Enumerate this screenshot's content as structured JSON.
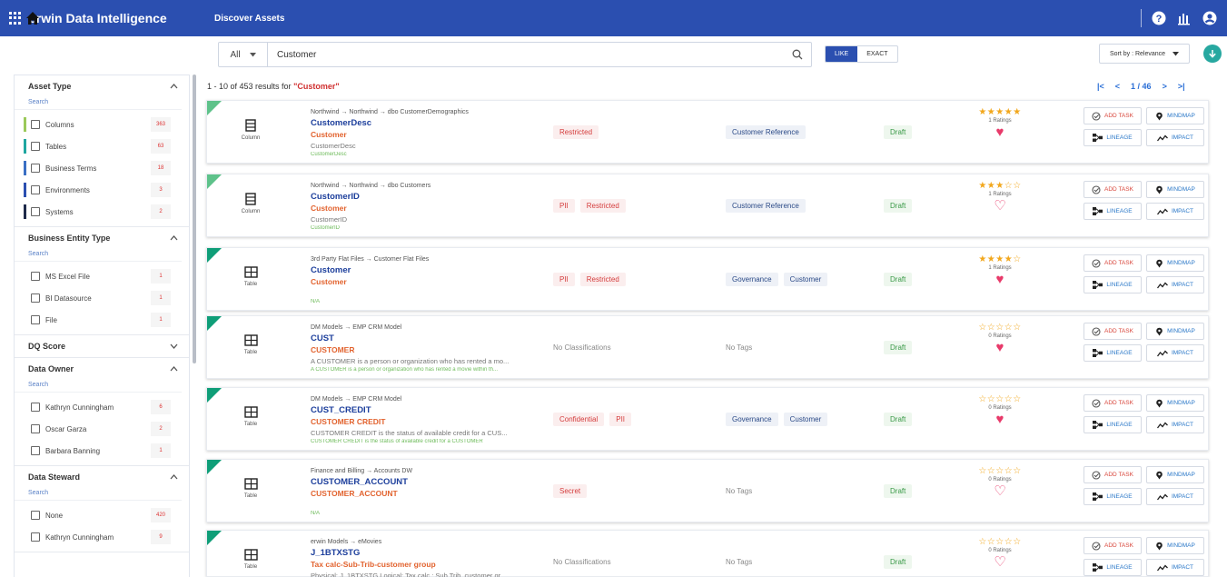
{
  "app": {
    "title": "erwin Data Intelligence",
    "section": "Discover Assets"
  },
  "search": {
    "scope": "All",
    "query": "Customer",
    "match_like": "LIKE",
    "match_exact": "EXACT"
  },
  "sort": {
    "label": "Sort by : Relevance"
  },
  "results": {
    "summary": "1 - 10 of 453 results for ",
    "term": "\"Customer\"",
    "page": "1 / 46"
  },
  "sidebar": {
    "facets": [
      {
        "title": "Asset Type",
        "search": "Search",
        "items": [
          {
            "label": "Columns",
            "count": "363",
            "color": "#9bc95a"
          },
          {
            "label": "Tables",
            "count": "63",
            "color": "#1fa6a0"
          },
          {
            "label": "Business Terms",
            "count": "18",
            "color": "#3a6fc4"
          },
          {
            "label": "Environments",
            "count": "3",
            "color": "#2b4fb0"
          },
          {
            "label": "Systems",
            "count": "2",
            "color": "#1e2a4a"
          }
        ]
      },
      {
        "title": "Business Entity Type",
        "search": "Search",
        "items": [
          {
            "label": "MS Excel File",
            "count": "1"
          },
          {
            "label": "BI Datasource",
            "count": "1"
          },
          {
            "label": "File",
            "count": "1"
          }
        ]
      },
      {
        "title": "DQ Score"
      },
      {
        "title": "Data Owner",
        "search": "Search",
        "items": [
          {
            "label": "Kathryn Cunningham",
            "count": "6"
          },
          {
            "label": "Oscar Garza",
            "count": "2"
          },
          {
            "label": "Barbara Banning",
            "count": "1"
          }
        ]
      },
      {
        "title": "Data Steward",
        "search": "Search",
        "items": [
          {
            "label": "None",
            "count": "420"
          },
          {
            "label": "Kathryn Cunningham",
            "count": "9"
          }
        ]
      }
    ]
  },
  "cards": [
    {
      "type": "Column",
      "path": "Northwind → Northwind → dbo CustomerDemographics",
      "name": "CustomerDesc",
      "business": "Customer",
      "desc": "CustomerDesc",
      "desc2": "CustomerDesc",
      "classifications": [
        "Restricted"
      ],
      "tags": [
        "Customer Reference"
      ],
      "status": "Draft",
      "stars": "★★★★★",
      "ratings": "1 Ratings",
      "heart": "♥"
    },
    {
      "type": "Column",
      "path": "Northwind → Northwind → dbo Customers",
      "name": "CustomerID",
      "business": "Customer",
      "desc": "CustomerID",
      "desc2": "CustomerID",
      "classifications": [
        "PII",
        "Restricted"
      ],
      "tags": [
        "Customer Reference"
      ],
      "status": "Draft",
      "stars": "★★★☆☆",
      "ratings": "1 Ratings",
      "heart": "♡"
    },
    {
      "type": "Table",
      "path": "3rd Party Flat Files → Customer Flat Files",
      "name": "Customer",
      "business": "Customer",
      "desc": "",
      "desc2": "N/A",
      "classifications": [
        "PII",
        "Restricted"
      ],
      "tags": [
        "Governance",
        "Customer"
      ],
      "status": "Draft",
      "stars": "★★★★☆",
      "ratings": "1 Ratings",
      "heart": "♥"
    },
    {
      "type": "Table",
      "path": "DM Models → EMP CRM Model",
      "name": "CUST",
      "business": "CUSTOMER",
      "desc": "A CUSTOMER is a person or organization who has rented a mo...",
      "desc2": "A CUSTOMER is a person or organization who has rented a movie within th...",
      "classifications": [],
      "classifications_empty": "No Classifications",
      "tags": [],
      "tags_empty": "No Tags",
      "status": "Draft",
      "stars": "☆☆☆☆☆",
      "ratings": "0 Ratings",
      "heart": "♥"
    },
    {
      "type": "Table",
      "path": "DM Models → EMP CRM Model",
      "name": "CUST_CREDIT",
      "business": "CUSTOMER CREDIT",
      "desc": "CUSTOMER CREDIT is the status of available credit for a CUS...",
      "desc2": "CUSTOMER CREDIT is the status of available credit for a CUSTOMER",
      "classifications": [
        "Confidential",
        "PII"
      ],
      "tags": [
        "Governance",
        "Customer"
      ],
      "status": "Draft",
      "stars": "☆☆☆☆☆",
      "ratings": "0 Ratings",
      "heart": "♥"
    },
    {
      "type": "Table",
      "path": "Finance and Billing → Accounts DW",
      "name": "CUSTOMER_ACCOUNT",
      "business": "CUSTOMER_ACCOUNT",
      "desc": "",
      "desc2": "N/A",
      "classifications": [
        "Secret"
      ],
      "tags": [],
      "tags_empty": "No Tags",
      "status": "Draft",
      "stars": "☆☆☆☆☆",
      "ratings": "0 Ratings",
      "heart": "♡"
    },
    {
      "type": "Table",
      "path": "erwin Models → eMovies",
      "name": "J_1BTXSTG",
      "business": "Tax calc-Sub-Trib-customer group",
      "desc": "Physical: J_1BTXSTG Logical: Tax calc.: Sub Trib. customer gr...",
      "desc2": "",
      "classifications": [],
      "classifications_empty": "No Classifications",
      "tags": [],
      "tags_empty": "No Tags",
      "status": "Draft",
      "stars": "☆☆☆☆☆",
      "ratings": "0 Ratings",
      "heart": "♡"
    }
  ],
  "actions": {
    "add_task": "ADD TASK",
    "mindmap": "MINDMAP",
    "lineage": "LINEAGE",
    "impact": "IMPACT"
  },
  "colors": {
    "brand": "#2b4fb0",
    "accent_teal": "#27a8a0",
    "red": "#d43c3c",
    "orange": "#e2632f",
    "star": "#f2a71c",
    "heart": "#e83a6a"
  }
}
